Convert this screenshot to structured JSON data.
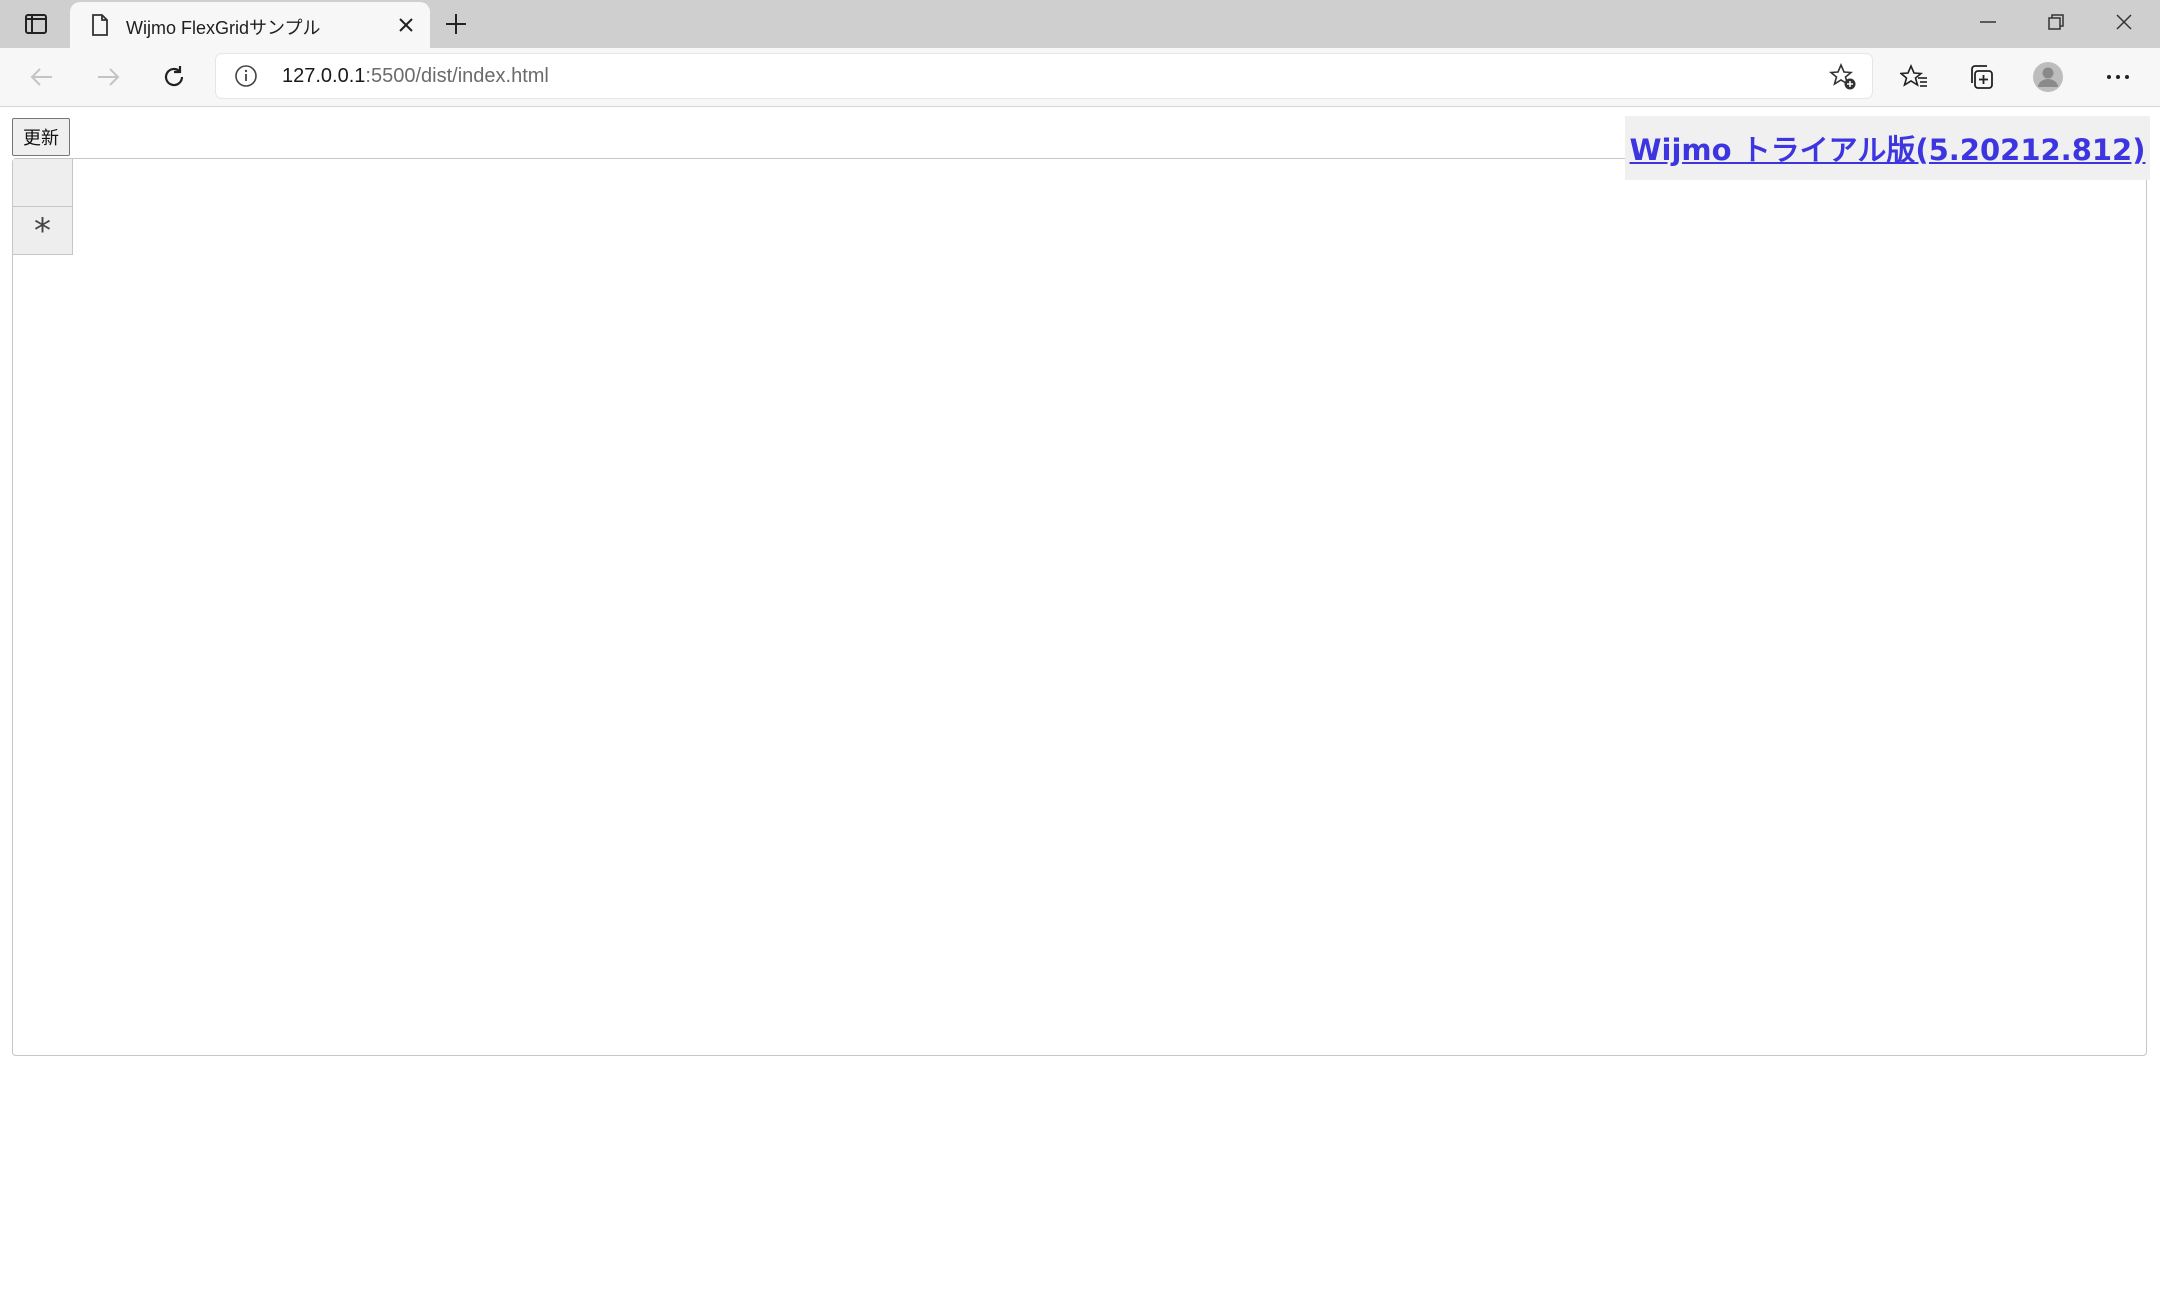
{
  "browser": {
    "tab": {
      "title": "Wijmo FlexGridサンプル",
      "favicon": "page-icon"
    },
    "address_bar": {
      "host": "127.0.0.1",
      "path": ":5500/dist/index.html"
    },
    "icons": {
      "tab_actions": "tab-actions-icon",
      "close_tab": "close-icon",
      "new_tab": "plus-icon",
      "minimize": "minimize-icon",
      "restore": "restore-icon",
      "close_window": "close-icon",
      "back": "back-arrow-icon",
      "forward": "forward-arrow-icon",
      "reload": "reload-icon",
      "site_info": "info-icon",
      "add_favorite": "star-add-icon",
      "favorites": "favorites-icon",
      "collections": "collections-icon",
      "profile": "profile-icon",
      "more": "more-icon"
    }
  },
  "page": {
    "refresh_button_label": "更新",
    "grid": {
      "new_row_indicator": "*"
    },
    "trial_banner": {
      "text": "Wijmo トライアル版(5.20212.812)",
      "color": "#3c35e0"
    }
  }
}
